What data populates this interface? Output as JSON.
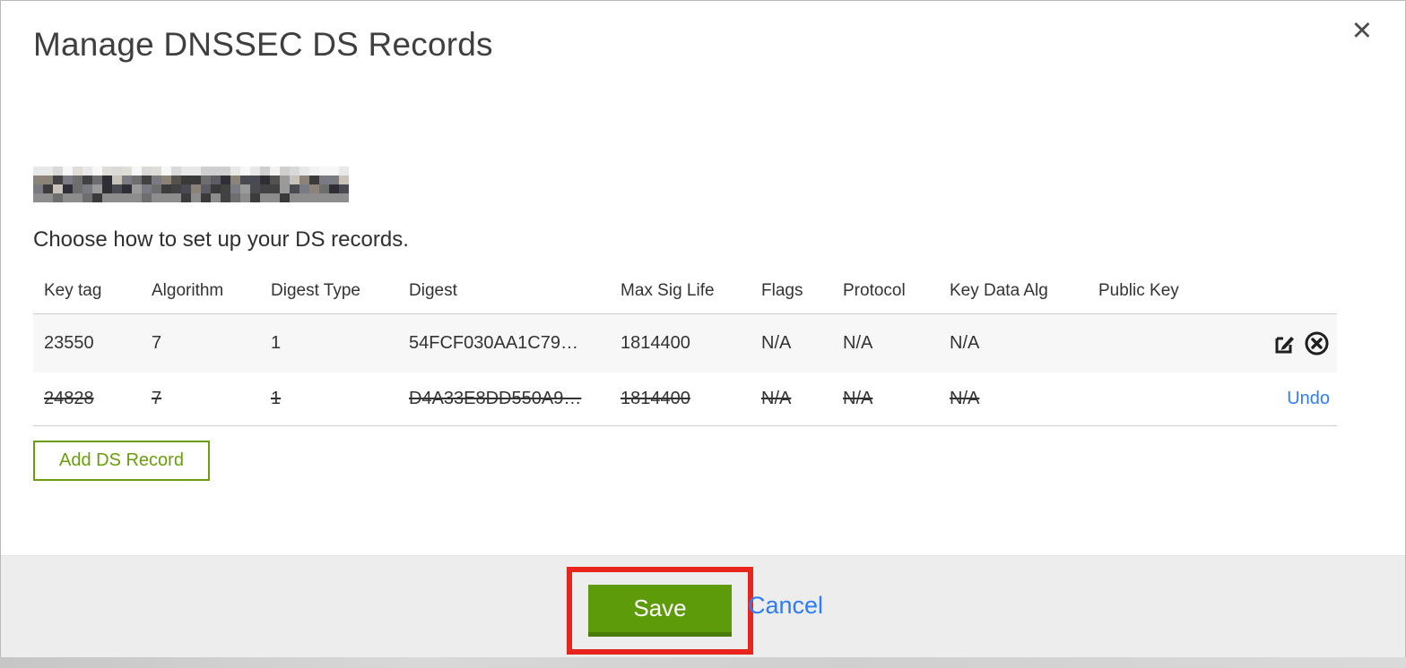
{
  "modal": {
    "title": "Manage DNSSEC DS Records",
    "close_icon": "close-x",
    "domain": "(redacted pixelated domain name)",
    "subtitle": "Choose how to set up your DS records."
  },
  "table": {
    "headers": [
      "Key tag",
      "Algorithm",
      "Digest Type",
      "Digest",
      "Max Sig Life",
      "Flags",
      "Protocol",
      "Key Data Alg",
      "Public Key"
    ],
    "rows": [
      {
        "key_tag": "23550",
        "algorithm": "7",
        "digest_type": "1",
        "digest": "54FCF030AA1C79…",
        "max_sig_life": "1814400",
        "flags": "N/A",
        "protocol": "N/A",
        "key_data_alg": "N/A",
        "public_key": "",
        "state": "active",
        "actions": [
          "edit",
          "remove"
        ]
      },
      {
        "key_tag": "24828",
        "algorithm": "7",
        "digest_type": "1",
        "digest": "D4A33E8DD550A9…",
        "max_sig_life": "1814400",
        "flags": "N/A",
        "protocol": "N/A",
        "key_data_alg": "N/A",
        "public_key": "",
        "state": "deleted",
        "undo_label": "Undo"
      }
    ]
  },
  "buttons": {
    "add_ds_record": "Add DS Record",
    "save": "Save",
    "cancel": "Cancel"
  },
  "colors": {
    "accent_green": "#5d9b0b",
    "outline_green": "#6a9e0c",
    "link_blue": "#2e7cf6",
    "annotation_red": "#e8251d",
    "footer_gray": "#ededed",
    "row_gray": "#f7f7f7"
  }
}
